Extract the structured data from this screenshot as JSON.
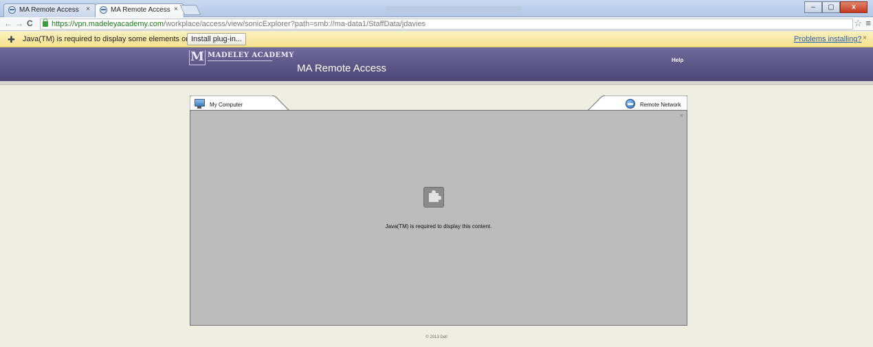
{
  "browser": {
    "tabs": [
      {
        "label": "MA Remote Access",
        "close": "×",
        "active": false
      },
      {
        "label": "MA Remote Access",
        "close": "×",
        "active": true
      }
    ],
    "window_controls": {
      "minimize": "–",
      "maximize": "▢",
      "close": "x"
    },
    "address": {
      "host": "https://vpn.madeleyacademy.com",
      "path": "/workplace/access/view/sonicExplorer?path=smb://ma-data1/StaffData/jdavies"
    },
    "nav": {
      "back": "←",
      "forward": "→",
      "reload": "C"
    },
    "star": "☆",
    "menu": "≡"
  },
  "infobar": {
    "message": "Java(TM) is required to display some elements on this page.",
    "install_button": "Install plug-in...",
    "problems_link": "Problems installing?",
    "close": "×"
  },
  "header": {
    "logo_initial": "M",
    "logo_text": "MADELEY ACADEMY",
    "title": "MA Remote Access",
    "help": "Help",
    "colors": {
      "top": "#6f6a99",
      "bottom": "#4b4677"
    }
  },
  "panel": {
    "left_tab": "My Computer",
    "right_tab": "Remote Network",
    "close": "×",
    "plugin_message": "Java(TM) is required to display this content."
  },
  "footer": {
    "text": "© 2013 Dell"
  }
}
